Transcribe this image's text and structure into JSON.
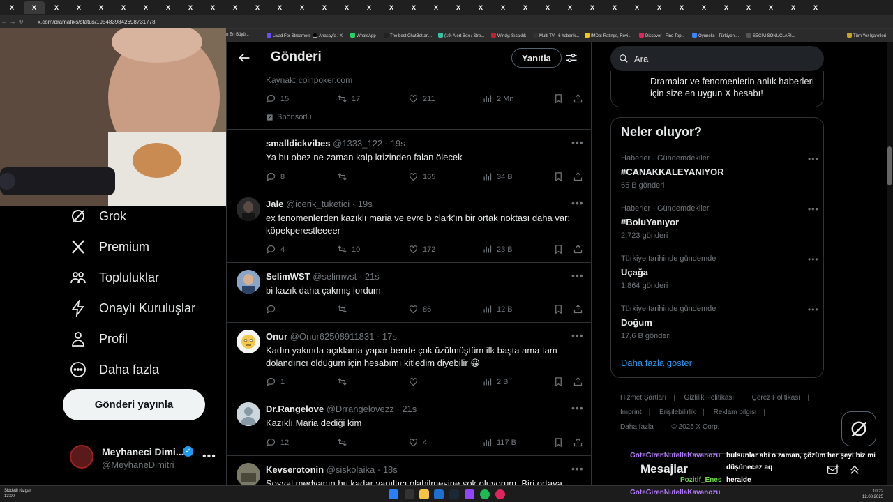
{
  "browser": {
    "tabs": [
      "X",
      "X",
      "X",
      "X",
      "X",
      "X",
      "X",
      "X",
      "X",
      "X",
      "X",
      "X",
      "X",
      "X",
      "X",
      "X",
      "X",
      "X",
      "X",
      "X",
      "X",
      "X",
      "X",
      "X",
      "X",
      "X",
      "X",
      "X",
      "X",
      "X",
      "X",
      "X",
      "X",
      "X",
      "X",
      "X",
      "X"
    ],
    "url": "x.com/dramafixs/status/1954839842698731778",
    "bookmarks": [
      "ye'nin En Büyü...",
      "Livad For Streamers",
      "Anasayfa / X",
      "WhatsApp",
      "The best ChatBot an...",
      "(19) Alert Box / Stre...",
      "Windy: Sıcaklık",
      "Multi TV - 6 haber k...",
      "IMDb: Ratings, Revi...",
      "Discover - Find Top...",
      "Oyuneks - Türkiyeni...",
      "SEÇİM SONUÇLARI...",
      "Tüm Yer İşaretleri"
    ]
  },
  "nav": {
    "items": [
      "Grok",
      "Premium",
      "Topluluklar",
      "Onaylı Kuruluşlar",
      "Profil",
      "Daha fazla"
    ],
    "post_button": "Gönderi yayınla",
    "profile": {
      "name": "Meyhaneci Dimi...",
      "handle": "@MeyhaneDimitri"
    }
  },
  "header": {
    "title": "Gönderi",
    "reply_label": "Yanıtla"
  },
  "ad": {
    "source": "Kaynak: coinpoker.com",
    "replies": "15",
    "reposts": "17",
    "likes": "211",
    "views": "2 Mn",
    "sponsored": "Sponsorlu"
  },
  "tweets": [
    {
      "name": "smalldickvibes",
      "handle": "@1333_122",
      "time": "· 19s",
      "text": "Ya bu obez ne zaman kalp krizinden falan ölecek",
      "replies": "8",
      "reposts": "",
      "likes": "165",
      "views": "34 B"
    },
    {
      "name": "Jale",
      "handle": "@icerik_tuketici",
      "time": "· 19s",
      "text": "ex fenomenlerden kazıklı maria ve evre b clark'ın bir ortak noktası daha var: köpekperestleeeer",
      "replies": "4",
      "reposts": "10",
      "likes": "172",
      "views": "23 B"
    },
    {
      "name": "SelimWST",
      "handle": "@selimwst",
      "time": "· 21s",
      "text": "bi kazık daha çakmış lordum",
      "replies": "",
      "reposts": "",
      "likes": "86",
      "views": "12 B"
    },
    {
      "name": "Onur",
      "handle": "@Onur62508911831",
      "time": "· 17s",
      "text": "Kadın yakında açıklama yapar bende çok üzülmüştüm ilk başta ama tam dolandırıcı öldüğüm için hesabımı kitledim diyebilir 😀",
      "replies": "1",
      "reposts": "",
      "likes": "",
      "views": "2 B"
    },
    {
      "name": "Dr.Rangelove",
      "handle": "@Drrangelovezz",
      "time": "· 21s",
      "text": "Kazıklı Maria dediği kim",
      "replies": "12",
      "reposts": "",
      "likes": "4",
      "views": "117 B"
    },
    {
      "name": "Kevserotonin",
      "handle": "@siskolaika",
      "time": "· 18s",
      "text": "Sosyal medyanın bu kadar yanıltıcı olabilmesine şok oluyorum. Biri ortaya",
      "replies": "",
      "reposts": "",
      "likes": "",
      "views": ""
    }
  ],
  "search": {
    "placeholder": "Ara"
  },
  "promo": {
    "text": "Dramalar ve fenomenlerin anlık haberleri için size en uygun X hesabı!"
  },
  "trends": {
    "title": "Neler oluyor?",
    "items": [
      {
        "meta": "Haberler · Gündemdekiler",
        "name": "#CANAKKALEYANIYOR",
        "count": "65 B gönderi"
      },
      {
        "meta": "Haberler · Gündemdekiler",
        "name": "#BoluYanıyor",
        "count": "2.723 gönderi"
      },
      {
        "meta": "Türkiye tarihinde gündemde",
        "name": "Uçağa",
        "count": "1.864 gönderi"
      },
      {
        "meta": "Türkiye tarihinde gündemde",
        "name": "Doğum",
        "count": "17,6 B gönderi"
      }
    ],
    "show_more": "Daha fazla göster"
  },
  "footer": {
    "links": [
      "Hizmet Şartları",
      "Gizlilik Politikası",
      "Çerez Politikası",
      "Imprint",
      "Erişilebilirlik",
      "Reklam bilgisi",
      "Daha fazla ···",
      "© 2025 X Corp."
    ]
  },
  "messages": {
    "title": "Mesajlar"
  },
  "chat": {
    "user1": "GoteGirenNutellaKavanozu",
    "msg1a": "bulsunlar abi o zaman, çözüm her şeyi biz mi",
    "msg1b": "düşünecez aq",
    "user2": "Pozitif_Enes",
    "msg2": "heralde",
    "user3": "GoteGirenNutellaKavanozu"
  },
  "taskbar": {
    "weather": "Şiddetli rüzgar",
    "weather_time": "13:00",
    "time": "10:22",
    "date": "12.08.2025"
  },
  "colors": {
    "accent": "#1d9bf0",
    "bg": "#000000",
    "border": "#2f3336",
    "muted": "#71767b"
  }
}
